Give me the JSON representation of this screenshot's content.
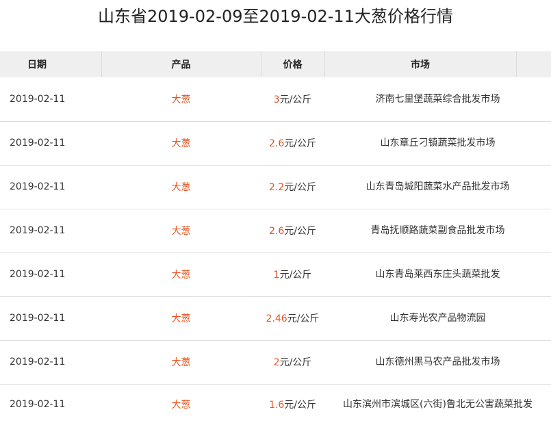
{
  "title": "山东省2019-02-09至2019-02-11大葱价格行情",
  "table": {
    "headers": {
      "date": "日期",
      "product": "产品",
      "price": "价格",
      "market": "市场"
    },
    "rows": [
      {
        "date": "2019-02-11",
        "product": "大葱",
        "price": "3",
        "unit": "元/公斤",
        "market": "济南七里堡蔬菜综合批发市场"
      },
      {
        "date": "2019-02-11",
        "product": "大葱",
        "price": "2.6",
        "unit": "元/公斤",
        "market": "山东章丘刁镇蔬菜批发市场"
      },
      {
        "date": "2019-02-11",
        "product": "大葱",
        "price": "2.2",
        "unit": "元/公斤",
        "market": "山东青岛城阳蔬菜水产品批发市场"
      },
      {
        "date": "2019-02-11",
        "product": "大葱",
        "price": "2.6",
        "unit": "元/公斤",
        "market": "青岛抚顺路蔬菜副食品批发市场"
      },
      {
        "date": "2019-02-11",
        "product": "大葱",
        "price": "1",
        "unit": "元/公斤",
        "market": "山东青岛莱西东庄头蔬菜批发"
      },
      {
        "date": "2019-02-11",
        "product": "大葱",
        "price": "2.46",
        "unit": "元/公斤",
        "market": "山东寿光农产品物流园"
      },
      {
        "date": "2019-02-11",
        "product": "大葱",
        "price": "2",
        "unit": "元/公斤",
        "market": "山东德州黑马农产品批发市场"
      },
      {
        "date": "2019-02-11",
        "product": "大葱",
        "price": "1.6",
        "unit": "元/公斤",
        "market": "山东滨州市滨城区(六街)鲁北无公害蔬菜批发"
      }
    ]
  },
  "colors": {
    "accent": "#e8531f",
    "header_bg": "#efefef",
    "text": "#333333"
  }
}
